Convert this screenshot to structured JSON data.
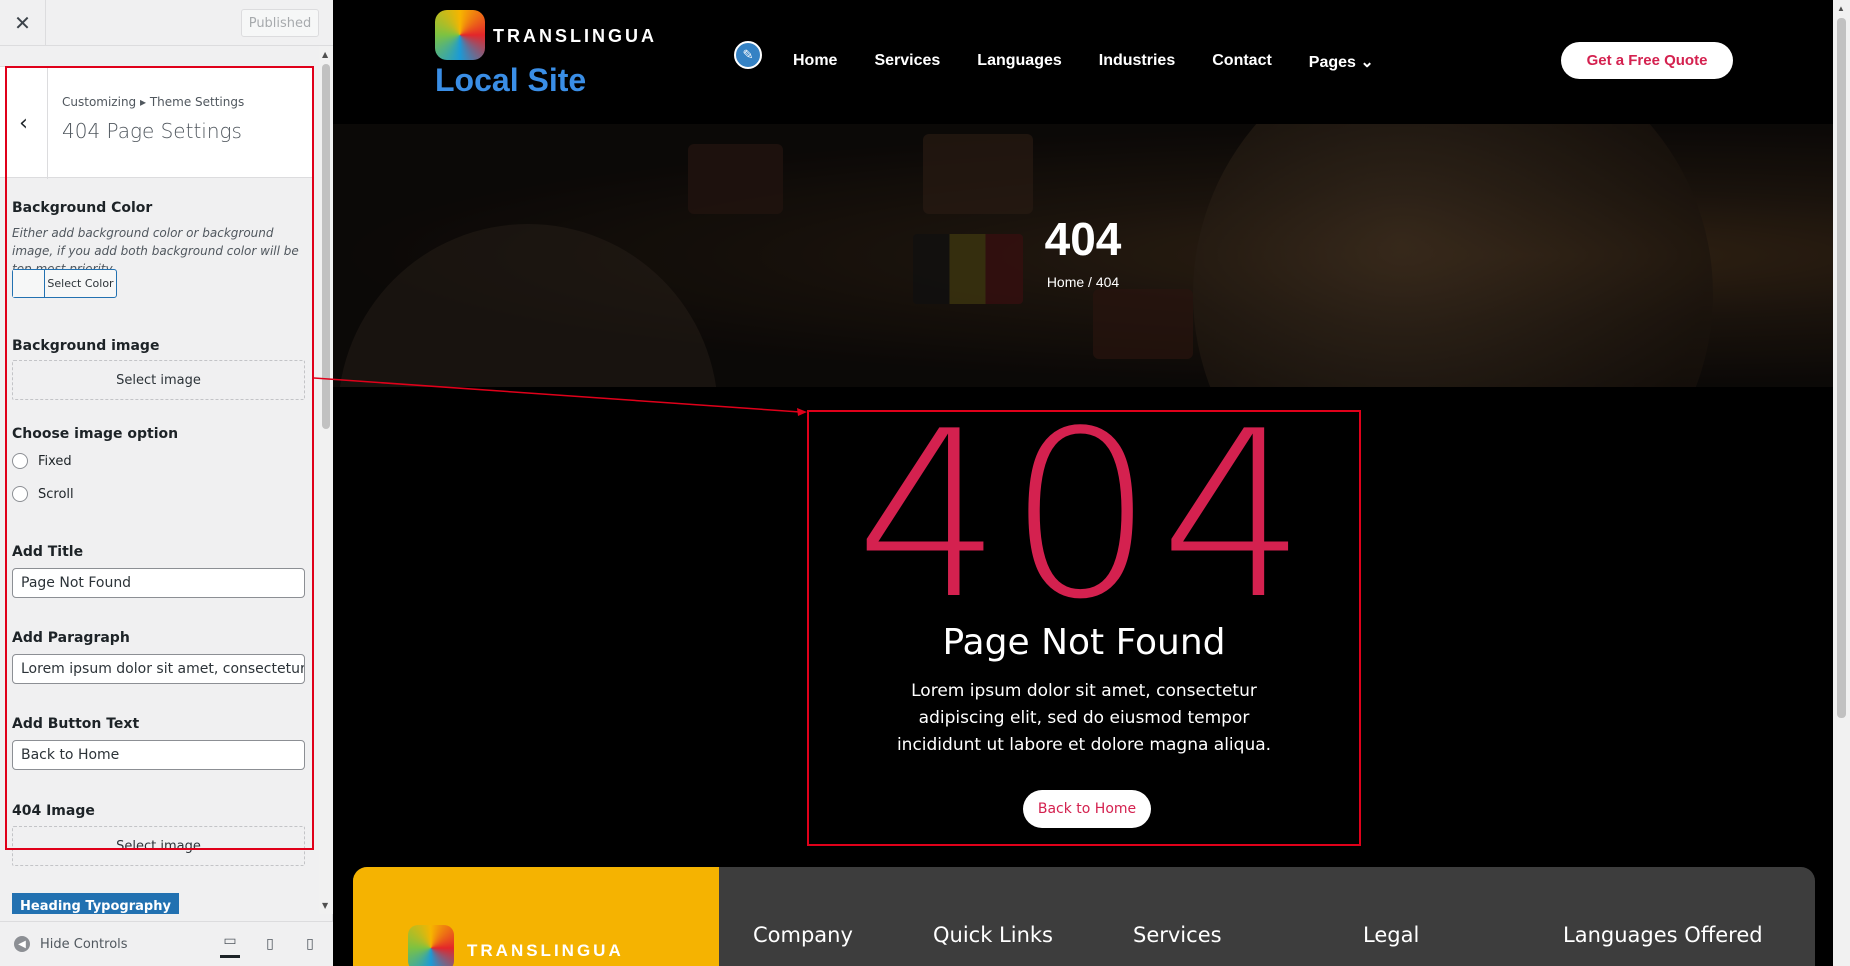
{
  "sidebar": {
    "close_icon": "close-icon",
    "published_label": "Published",
    "breadcrumb": "Customizing ▸ Theme Settings",
    "section_title": "404 Page Settings",
    "bg_color": {
      "label": "Background Color",
      "description": "Either add background color or background image, if you add both background color will be top most priority",
      "button": "Select Color"
    },
    "bg_image": {
      "label": "Background image",
      "button": "Select image"
    },
    "image_option": {
      "label": "Choose image option",
      "options": [
        "Fixed",
        "Scroll"
      ]
    },
    "title": {
      "label": "Add Title",
      "value": "Page Not Found"
    },
    "paragraph": {
      "label": "Add Paragraph",
      "value": "Lorem ipsum dolor sit amet, consectetur ad"
    },
    "button_text": {
      "label": "Add Button Text",
      "value": "Back to Home"
    },
    "image_404": {
      "label": "404 Image",
      "button": "Select image"
    },
    "heading_typography": "Heading Typography",
    "hide_controls": "Hide Controls"
  },
  "site": {
    "logo_word": "TRANSLINGUA",
    "site_name": "Local Site",
    "nav": [
      "Home",
      "Services",
      "Languages",
      "Industries",
      "Contact",
      "Pages"
    ],
    "quote_button": "Get a Free Quote",
    "hero_title": "404",
    "hero_breadcrumb": "Home / 404",
    "not_found": {
      "code": "404",
      "title": "Page Not Found",
      "paragraph": "Lorem ipsum dolor sit amet, consectetur adipiscing elit, sed do eiusmod tempor incididunt ut labore et dolore magna aliqua.",
      "button": "Back to Home"
    },
    "footer": {
      "logo_word": "TRANSLINGUA",
      "columns": [
        "Company",
        "Quick Links",
        "Services",
        "Legal",
        "Languages Offered"
      ]
    }
  },
  "colors": {
    "accent": "#d4214f",
    "footer_yellow": "#f5b301",
    "site_name_blue": "#3a8ee6",
    "wp_blue": "#2271b1",
    "annotation_red": "#e0001a"
  }
}
